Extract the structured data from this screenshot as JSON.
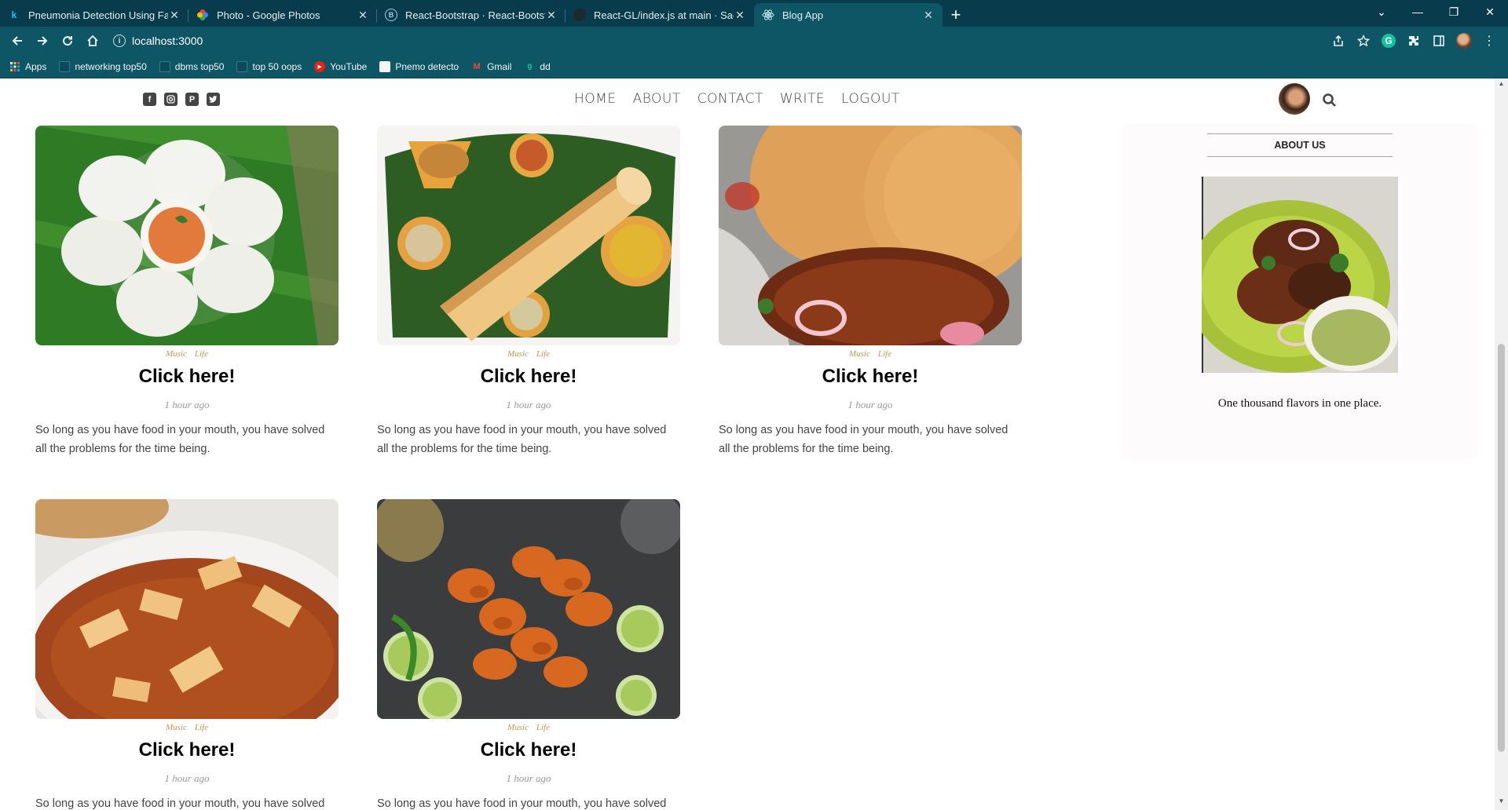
{
  "browser": {
    "tabs": [
      {
        "title": "Pneumonia Detection Using Fast",
        "icon": "kaggle-icon",
        "active": false
      },
      {
        "title": "Photo - Google Photos",
        "icon": "google-photos-icon",
        "active": false
      },
      {
        "title": "React-Bootstrap · React-Bootstrap",
        "icon": "react-bootstrap-icon",
        "active": false
      },
      {
        "title": "React-GL/index.js at main · Sache",
        "icon": "github-icon",
        "active": false
      },
      {
        "title": "Blog App",
        "icon": "react-icon",
        "active": true
      }
    ],
    "url": "localhost:3000",
    "bookmarks": [
      {
        "label": "Apps",
        "icon": "apps-grid-icon"
      },
      {
        "label": "networking top50",
        "icon": "bookmark-icon"
      },
      {
        "label": "dbms top50",
        "icon": "bookmark-icon"
      },
      {
        "label": "top 50 oops",
        "icon": "bookmark-icon"
      },
      {
        "label": "YouTube",
        "icon": "youtube-icon"
      },
      {
        "label": "Pnemo detecto",
        "icon": "document-icon"
      },
      {
        "label": "Gmail",
        "icon": "gmail-icon"
      },
      {
        "label": "dd",
        "icon": "grammarly-icon"
      }
    ]
  },
  "nav": {
    "social": [
      "facebook-icon",
      "instagram-icon",
      "pinterest-icon",
      "twitter-icon"
    ],
    "menu": [
      "HOME",
      "ABOUT",
      "CONTACT",
      "WRITE",
      "LOGOUT"
    ]
  },
  "posts": [
    {
      "cat1": "Music",
      "cat2": "Life",
      "title": "Click here!",
      "date": "1 hour ago",
      "desc": "So long as you have food in your mouth, you have solved all the problems for the time being.",
      "image": "idli-photo"
    },
    {
      "cat1": "Music",
      "cat2": "Life",
      "title": "Click here!",
      "date": "1 hour ago",
      "desc": "So long as you have food in your mouth, you have solved all the problems for the time being.",
      "image": "dosa-photo"
    },
    {
      "cat1": "Music",
      "cat2": "Life",
      "title": "Click here!",
      "date": "1 hour ago",
      "desc": "So long as you have food in your mouth, you have solved all the problems for the time being.",
      "image": "chole-bhature-photo"
    },
    {
      "cat1": "Music",
      "cat2": "Life",
      "title": "Click here!",
      "date": "1 hour ago",
      "desc": "So long as you have food in your mouth, you have solved all the problems for the time being.",
      "image": "paneer-curry-photo"
    },
    {
      "cat1": "Music",
      "cat2": "Life",
      "title": "Click here!",
      "date": "1 hour ago",
      "desc": "So long as you have food in your mouth, you have solved all the problems for the time being.",
      "image": "chicken-tikka-photo"
    }
  ],
  "sidebar": {
    "title": "ABOUT US",
    "image": "tandoori-chicken-photo",
    "text": "One thousand flavors in one place."
  },
  "colors": {
    "chrome_dark": "#083c4c",
    "chrome_toolbar": "#0e5566",
    "category": "#be9656",
    "nav_text": "#444444"
  }
}
